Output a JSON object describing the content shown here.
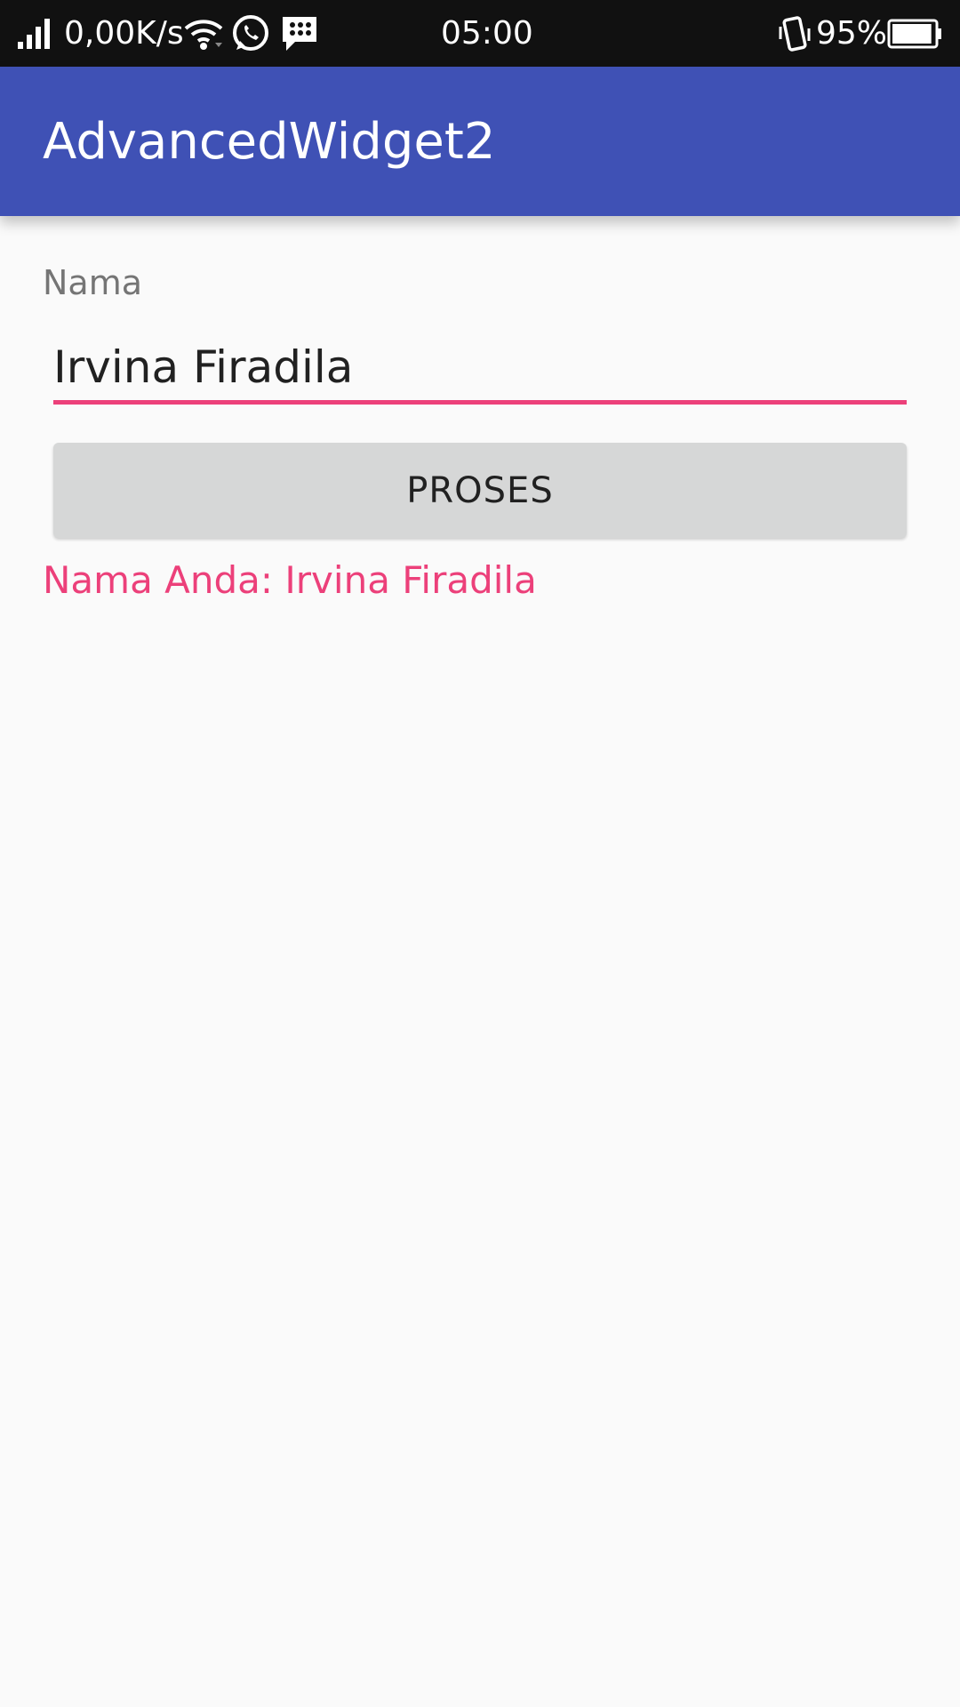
{
  "status_bar": {
    "network_speed": "0,00K/s",
    "time": "05:00",
    "battery_percent": "95%",
    "battery_level": 0.95,
    "icons": [
      "signal-icon",
      "wifi-icon",
      "whatsapp-icon",
      "bbm-icon",
      "vibrate-icon",
      "battery-icon"
    ]
  },
  "app_bar": {
    "title": "AdvancedWidget2",
    "color": "#3f51b5"
  },
  "form": {
    "label": "Nama",
    "input_value": "Irvina Firadila",
    "accent_color": "#ec407a",
    "button_label": "PROSES"
  },
  "result": {
    "text": "Nama Anda: Irvina Firadila",
    "color": "#ec407a"
  }
}
